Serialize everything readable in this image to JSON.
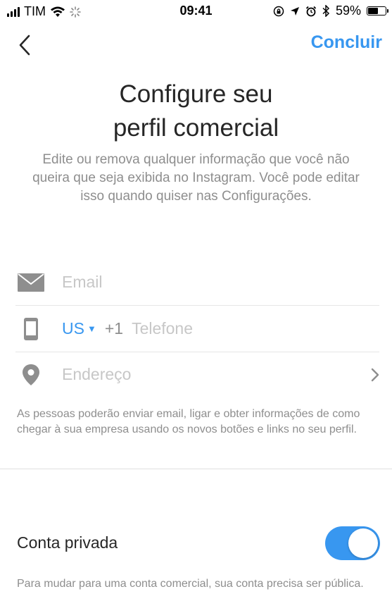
{
  "status_bar": {
    "carrier": "TIM",
    "time": "09:41",
    "battery": "59%",
    "battery_level": 0.59,
    "icons": [
      "signal-icon",
      "wifi-icon",
      "activity-spinner-icon",
      "rotation-lock-icon",
      "location-icon",
      "alarm-icon",
      "bluetooth-icon",
      "battery-icon"
    ]
  },
  "nav": {
    "back_icon": "chevron-left-icon",
    "done_label": "Concluir"
  },
  "header": {
    "title_line1": "Configure seu",
    "title_line2": "perfil comercial",
    "subtitle": "Edite ou remova qualquer informação que você não queira que seja exibida no Instagram. Você pode editar isso quando quiser nas Configurações."
  },
  "form": {
    "email": {
      "icon": "mail-icon",
      "placeholder": "Email",
      "value": ""
    },
    "phone": {
      "icon": "phone-icon",
      "country": "US",
      "dial_code": "+1",
      "placeholder": "Telefone",
      "value": ""
    },
    "address": {
      "icon": "location-pin-icon",
      "placeholder": "Endereço",
      "chevron_icon": "chevron-right-icon"
    },
    "help": "As pessoas poderão enviar email, ligar e obter informações de como chegar à sua empresa usando os novos botões e links no seu perfil."
  },
  "private_account": {
    "label": "Conta privada",
    "enabled": true,
    "help": "Para mudar para uma conta comercial, sua conta precisa ser pública."
  },
  "colors": {
    "accent": "#3897f0",
    "text_primary": "#262626",
    "text_secondary": "#8e8e8e",
    "placeholder": "#c7c7c7",
    "icon": "#8e8e8e",
    "divider": "#e6e6e6"
  }
}
